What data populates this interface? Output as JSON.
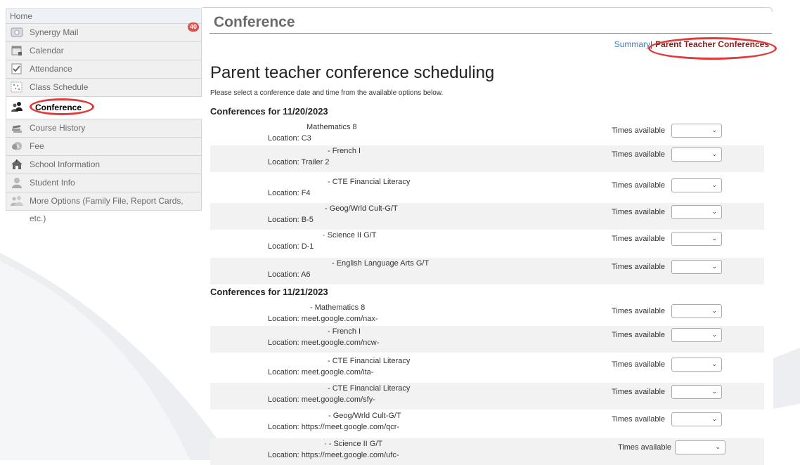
{
  "sidebar": {
    "home": "Home",
    "mail_badge": "40",
    "items": [
      {
        "label": "Synergy Mail",
        "icon": "mail-icon"
      },
      {
        "label": "Calendar",
        "icon": "calendar-icon"
      },
      {
        "label": "Attendance",
        "icon": "attendance-icon"
      },
      {
        "label": "Class Schedule",
        "icon": "schedule-icon"
      },
      {
        "label": "Conference",
        "icon": "conference-icon",
        "active": true
      },
      {
        "label": "Course History",
        "icon": "books-icon"
      },
      {
        "label": "Fee",
        "icon": "fee-icon"
      },
      {
        "label": "School Information",
        "icon": "school-icon"
      },
      {
        "label": "Student Info",
        "icon": "student-icon"
      },
      {
        "label": "More Options (Family File, Report Cards, etc.)",
        "icon": "more-options-icon"
      }
    ]
  },
  "main": {
    "title": "Conference",
    "breadcrumb": {
      "summary": "Summary",
      "separator": "|",
      "active": "Parent Teacher Conferences"
    },
    "heading": "Parent teacher conference scheduling",
    "instructions": "Please select a conference date and time from the available options below.",
    "times_label": "Times available",
    "groups": [
      {
        "date_label": "Conferences for 11/20/2023",
        "rows": [
          {
            "course": "Mathematics 8",
            "location": "Location: C3"
          },
          {
            "course": "- French I",
            "location": "Location: Trailer 2"
          },
          {
            "course": "- CTE Financial Literacy",
            "location": "Location: F4"
          },
          {
            "course": "- Geog/Wrld Cult-G/T",
            "location": "Location: B-5"
          },
          {
            "course": "· Science II G/T",
            "location": "Location: D-1"
          },
          {
            "course": "- English Language Arts G/T",
            "location": "Location: A6"
          }
        ]
      },
      {
        "date_label": "Conferences for 11/21/2023",
        "rows": [
          {
            "course": "- Mathematics 8",
            "location": "Location: meet.google.com/nax-"
          },
          {
            "course": "- French I",
            "location": "Location: meet.google.com/ncw-"
          },
          {
            "course": "- CTE Financial Literacy",
            "location": "Location: meet.google.com/ita-"
          },
          {
            "course": "- CTE Financial Literacy",
            "location": "Location: meet.google.com/sfy-"
          },
          {
            "course": "- Geog/Wrld Cult-G/T",
            "location": "Location: https://meet.google.com/qcr-"
          },
          {
            "course": "· - Science II G/T",
            "location": "Location: https://meet.google.com/ufc-"
          }
        ]
      }
    ]
  },
  "colors": {
    "highlight_circle": "#e03a3a",
    "link": "#3a7bbf",
    "active_crumb": "#8b1a1a",
    "badge": "#d9534f"
  }
}
